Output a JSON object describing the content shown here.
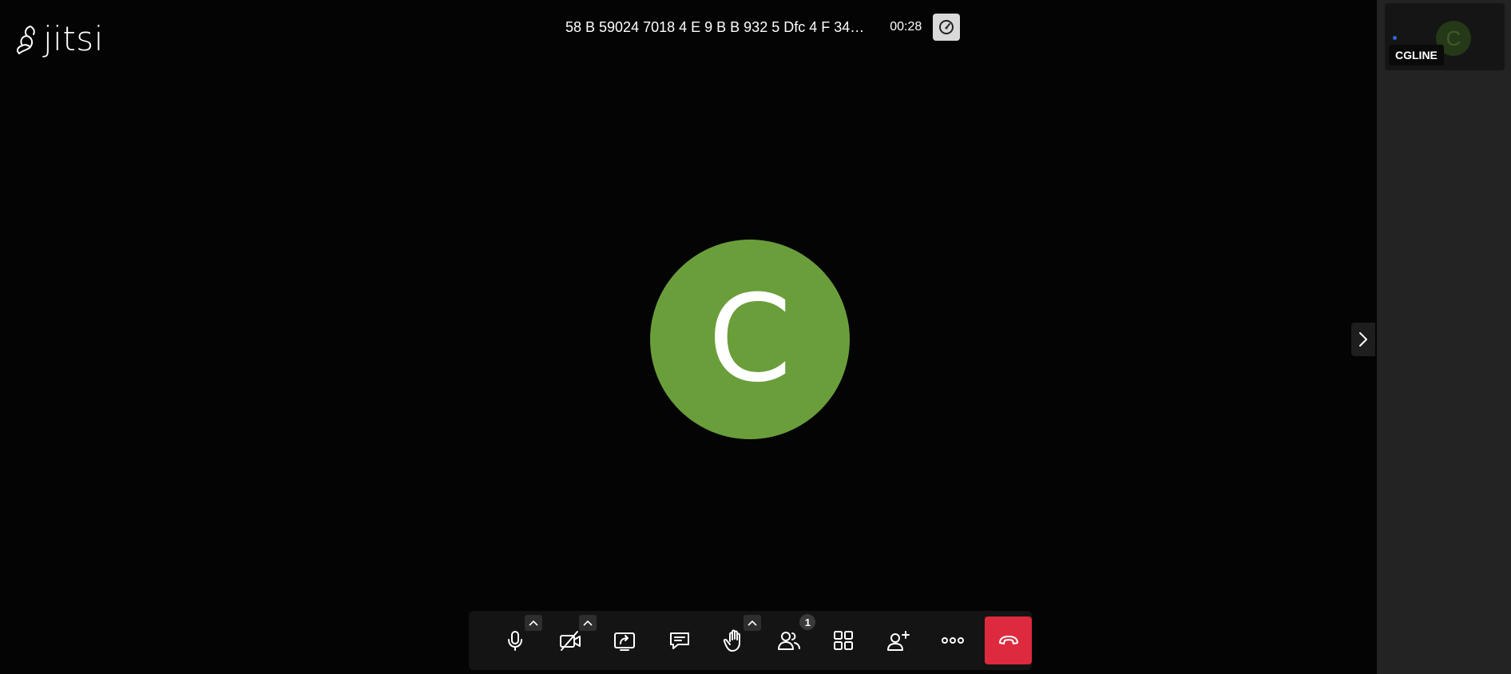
{
  "logo": {
    "text": "jitsi"
  },
  "header": {
    "subject": "58 B 59024 7018 4 E 9 B B 932 5 Dfc 4 F 34…",
    "timer": "00:28"
  },
  "participant": {
    "initial": "C",
    "color": "#6a9e3b"
  },
  "filmstrip": {
    "name": "CGLINE",
    "initial": "C"
  },
  "toolbar": {
    "buttons": [
      "microphone-icon",
      "camera-off-icon",
      "share-screen-icon",
      "chat-icon",
      "raise-hand-icon",
      "participants-icon",
      "tile-view-icon",
      "invite-icon",
      "more-icon",
      "hangup-icon"
    ],
    "participants_count": "1",
    "hangup_color": "#dd2a3f"
  }
}
